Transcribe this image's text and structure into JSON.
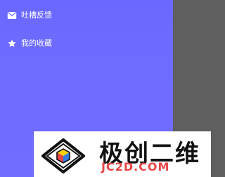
{
  "drawer": {
    "items": [
      {
        "label": "吐槽反馈",
        "icon": "mail-icon"
      },
      {
        "label": "我的收藏",
        "icon": "star-icon"
      }
    ]
  },
  "watermark": {
    "title": "极创二维",
    "domain": "JC2D.COM"
  },
  "colors": {
    "drawer_bg": "#6A68FF",
    "overlay": "#5F5F5F",
    "watermark_domain": "#E64646"
  }
}
